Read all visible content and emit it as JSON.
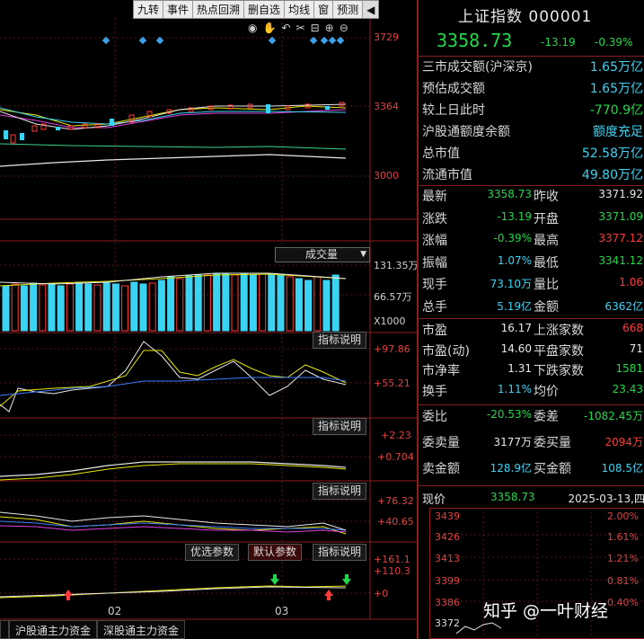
{
  "toolbar": {
    "items": [
      "九转",
      "事件",
      "热点回溯",
      "删自选",
      "均线",
      "窗",
      "预测"
    ],
    "icons": [
      "eye-icon",
      "hand-icon",
      "undo-icon",
      "scissors-icon",
      "lock-icon",
      "zoom-in-icon",
      "zoom-out-icon",
      "collapse-icon"
    ]
  },
  "kline": {
    "price_labels": [
      "3729",
      "3364",
      "3000"
    ]
  },
  "volume": {
    "dropdown_label": "成交量",
    "labels": [
      "131.35万",
      "66.57万",
      "X1000"
    ]
  },
  "indicators": [
    {
      "button": "指标说明",
      "labels": [
        "+97.86",
        "+55.21"
      ]
    },
    {
      "button": "指标说明",
      "labels": [
        "+2.23",
        "+0.704"
      ]
    },
    {
      "button": "指标说明",
      "labels": [
        "+76.32",
        "+40.65"
      ]
    },
    {
      "button": "指标说明",
      "labels": [
        "+161.1",
        "+110.3",
        "+0"
      ],
      "opt_button": "优选参数",
      "default_button": "默认参数"
    }
  ],
  "x_axis": [
    "02",
    "03"
  ],
  "bottom_tabs": [
    "沪股通主力资金",
    "深股通主力资金"
  ],
  "panel": {
    "title": "上证指数 000001",
    "price": "3358.73",
    "change": "-13.19",
    "change_pct": "-0.39%",
    "market_rows": [
      {
        "k": "三市成交额(沪深京)",
        "v": "1.65万亿",
        "c": "cyan"
      },
      {
        "k": "预估成交额",
        "v": "1.65万亿",
        "c": "cyan"
      },
      {
        "k": "较上日此时",
        "v": "-770.9亿",
        "c": "green"
      },
      {
        "k": "沪股通额度余额",
        "v": "额度充足",
        "c": "cyan"
      },
      {
        "k": "总市值",
        "v": "52.58万亿",
        "c": "cyan"
      },
      {
        "k": "流通市值",
        "v": "49.80万亿",
        "c": "cyan"
      }
    ],
    "quote_rows": [
      {
        "k1": "最新",
        "v1": "3358.73",
        "c1": "green",
        "k2": "昨收",
        "v2": "3371.92",
        "c2": "white"
      },
      {
        "k1": "涨跌",
        "v1": "-13.19",
        "c1": "green",
        "k2": "开盘",
        "v2": "3371.09",
        "c2": "green"
      },
      {
        "k1": "涨幅",
        "v1": "-0.39%",
        "c1": "green",
        "k2": "最高",
        "v2": "3377.12",
        "c2": "red"
      },
      {
        "k1": "振幅",
        "v1": "1.07%",
        "c1": "cyan",
        "k2": "最低",
        "v2": "3341.12",
        "c2": "green"
      },
      {
        "k1": "现手",
        "v1": "73.10万",
        "c1": "cyan",
        "k2": "量比",
        "v2": "1.06",
        "c2": "red"
      },
      {
        "k1": "总手",
        "v1": "5.19亿",
        "c1": "cyan",
        "k2": "金额",
        "v2": "6362亿",
        "c2": "cyan"
      }
    ],
    "stat_rows": [
      {
        "k1": "市盈",
        "v1": "16.17",
        "c1": "white",
        "k2": "上涨家数",
        "v2": "668",
        "c2": "red"
      },
      {
        "k1": "市盈(动)",
        "v1": "14.60",
        "c1": "white",
        "k2": "平盘家数",
        "v2": "71",
        "c2": "white"
      },
      {
        "k1": "市净率",
        "v1": "1.31",
        "c1": "white",
        "k2": "下跌家数",
        "v2": "1581",
        "c2": "green"
      },
      {
        "k1": "换手",
        "v1": "1.11%",
        "c1": "cyan",
        "k2": "均价",
        "v2": "23.43",
        "c2": "green"
      }
    ],
    "order_rows": [
      {
        "k1": "委比",
        "v1": "-20.53%",
        "c1": "green",
        "k2": "委差",
        "v2": "-1082.45万",
        "c2": "green"
      },
      {
        "k1": "委卖量",
        "v1": "3177万",
        "c1": "white",
        "k2": "委买量",
        "v2": "2094万",
        "c2": "red"
      },
      {
        "k1": "卖金额",
        "v1": "128.9亿",
        "c1": "cyan",
        "k2": "买金额",
        "v2": "108.5亿",
        "c2": "cyan"
      }
    ],
    "mini": {
      "label": "现价",
      "price": "3358.73",
      "date": "2025-03-13,四",
      "left_labels": [
        "3439",
        "3426",
        "3413",
        "3399",
        "3386",
        "3372"
      ],
      "right_labels": [
        "2.00%",
        "1.61%",
        "1.21%",
        "0.81%",
        "0.40%"
      ]
    },
    "watermark": "知乎 @一叶财经"
  }
}
